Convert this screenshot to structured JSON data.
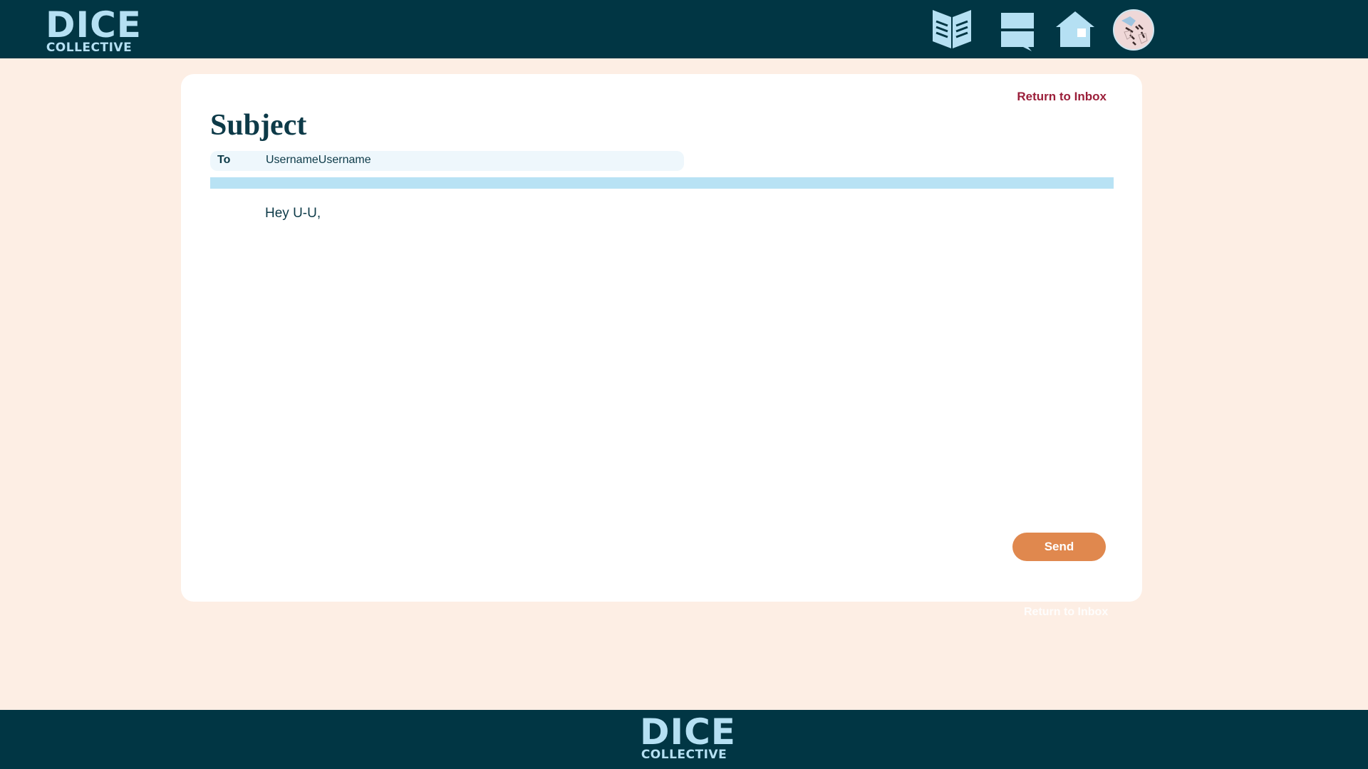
{
  "header": {
    "logo_top": "DICE",
    "logo_bottom": "COLLECTIVE",
    "nav_icons": [
      "book-icon",
      "chat-icon",
      "home-icon",
      "avatar-dice"
    ]
  },
  "message": {
    "return_label": "Return to Inbox",
    "subject": "Subject",
    "to_label": "To",
    "to_value": "UsernameUsername",
    "body": "Hey U-U,",
    "send_label": "Send"
  },
  "below_card": {
    "return_label": "Return to Inbox"
  },
  "footer": {
    "logo_top": "DICE",
    "logo_bottom": "COLLECTIVE"
  },
  "colors": {
    "header_bg": "#013644",
    "page_bg": "#fdeee4",
    "accent_light_blue": "#b5e0f3",
    "link_red": "#9b1f3a",
    "send_orange": "#e0884e"
  }
}
